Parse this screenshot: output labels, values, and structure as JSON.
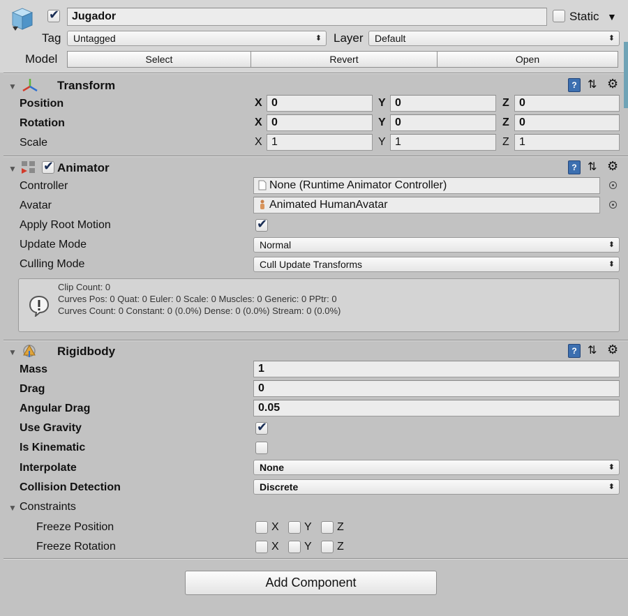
{
  "header": {
    "active_checked": true,
    "name": "Jugador",
    "static_label": "Static",
    "static_checked": false,
    "tag_label": "Tag",
    "tag_value": "Untagged",
    "layer_label": "Layer",
    "layer_value": "Default",
    "model_label": "Model",
    "model_buttons": [
      "Select",
      "Revert",
      "Open"
    ]
  },
  "transform": {
    "title": "Transform",
    "rows": [
      {
        "label": "Position",
        "x": "0",
        "y": "0",
        "z": "0"
      },
      {
        "label": "Rotation",
        "x": "0",
        "y": "0",
        "z": "0"
      },
      {
        "label": "Scale",
        "x": "1",
        "y": "1",
        "z": "1"
      }
    ],
    "axis": [
      "X",
      "Y",
      "Z"
    ]
  },
  "animator": {
    "title": "Animator",
    "enabled": true,
    "controller_label": "Controller",
    "controller_value": "None (Runtime Animator Controller)",
    "avatar_label": "Avatar",
    "avatar_value": "Animated HumanAvatar",
    "apply_root_motion_label": "Apply Root Motion",
    "apply_root_motion": true,
    "update_mode_label": "Update Mode",
    "update_mode_value": "Normal",
    "culling_mode_label": "Culling Mode",
    "culling_mode_value": "Cull Update Transforms",
    "info_lines": [
      "Clip Count: 0",
      "Curves Pos: 0 Quat: 0 Euler: 0 Scale: 0 Muscles: 0 Generic: 0 PPtr: 0",
      "Curves Count: 0 Constant: 0 (0.0%) Dense: 0 (0.0%) Stream: 0 (0.0%)"
    ]
  },
  "rigidbody": {
    "title": "Rigidbody",
    "mass_label": "Mass",
    "mass_value": "1",
    "drag_label": "Drag",
    "drag_value": "0",
    "angular_drag_label": "Angular Drag",
    "angular_drag_value": "0.05",
    "use_gravity_label": "Use Gravity",
    "use_gravity": true,
    "is_kinematic_label": "Is Kinematic",
    "is_kinematic": false,
    "interpolate_label": "Interpolate",
    "interpolate_value": "None",
    "collision_label": "Collision Detection",
    "collision_value": "Discrete",
    "constraints_label": "Constraints",
    "freeze_position_label": "Freeze Position",
    "freeze_rotation_label": "Freeze Rotation",
    "axis": [
      "X",
      "Y",
      "Z"
    ]
  },
  "footer": {
    "add_component_label": "Add Component"
  },
  "colors": {
    "background": "#c2c2c2",
    "header_background": "#d6d6d6",
    "field_background": "#ececec",
    "checkmark": "#1a2e55"
  }
}
